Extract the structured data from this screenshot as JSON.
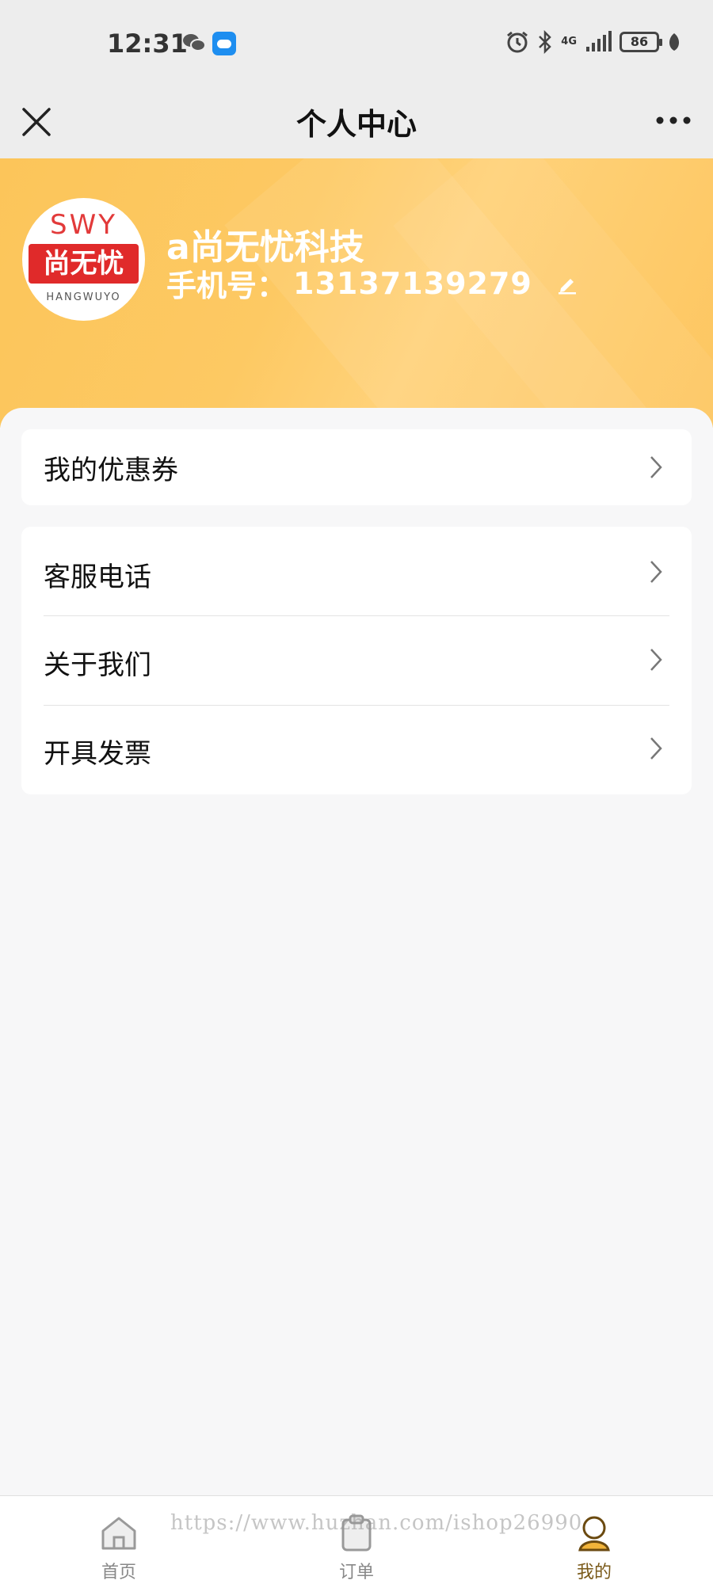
{
  "status_bar": {
    "time": "12:31",
    "network": "4G",
    "battery": "86",
    "icons": [
      "wechat-icon",
      "weather-icon",
      "alarm-icon",
      "bluetooth-icon",
      "signal-icon",
      "battery-icon",
      "leaf-icon"
    ]
  },
  "nav": {
    "title": "个人中心",
    "close_icon": "close-icon",
    "more_icon": "more-icon"
  },
  "profile": {
    "avatar_logo_top": "SWY",
    "avatar_logo_main": "尚无忧",
    "avatar_logo_bottom": "HANGWUYO",
    "name": "a尚无忧科技",
    "phone_label": "手机号：",
    "phone": "13137139279",
    "edit_icon": "edit-icon"
  },
  "menu": {
    "coupon_label": "我的优惠券",
    "items": [
      {
        "label": "客服电话"
      },
      {
        "label": "关于我们"
      },
      {
        "label": "开具发票"
      }
    ]
  },
  "tab_bar": {
    "tabs": [
      {
        "label": "首页",
        "icon": "home-icon",
        "active": false
      },
      {
        "label": "订单",
        "icon": "clipboard-icon",
        "active": false
      },
      {
        "label": "我的",
        "icon": "user-icon",
        "active": true
      }
    ]
  },
  "watermark": "https://www.huzhan.com/ishop26990",
  "colors": {
    "header_bg": "#fcc55a",
    "active_tab": "#7a5a1a",
    "inactive_tab": "#888888"
  }
}
